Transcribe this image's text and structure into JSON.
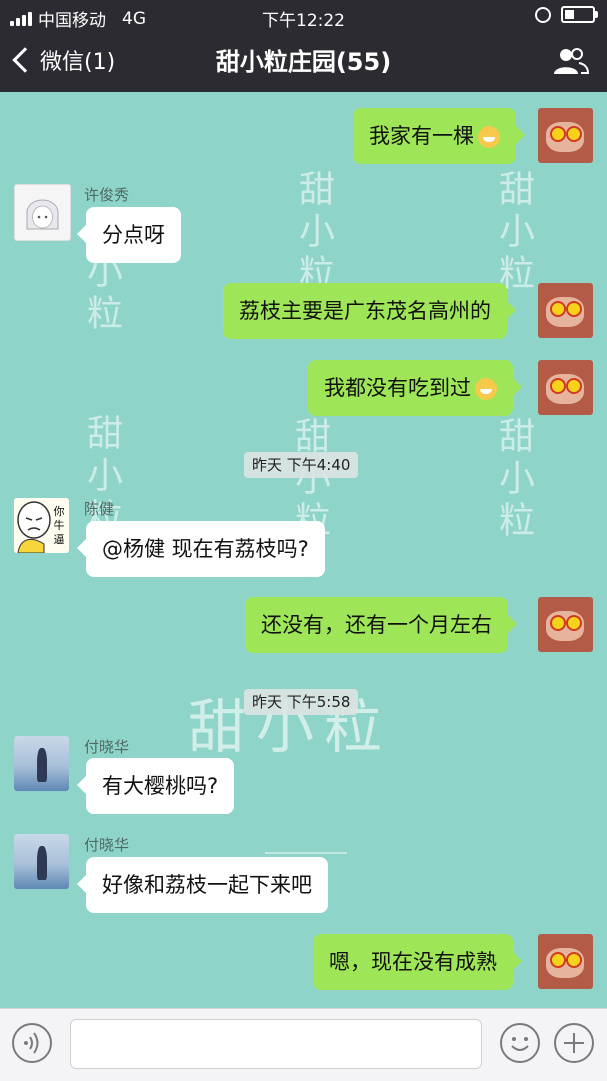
{
  "status_bar": {
    "carrier": "中国移动",
    "network": "4G",
    "time": "下午12:22"
  },
  "header": {
    "back_label": "微信(1)",
    "title": "甜小粒庄园(55)",
    "group_icon": "group-members-icon"
  },
  "watermark": {
    "small": "甜小粒",
    "big": "甜小粒"
  },
  "messages": [
    {
      "side": "right",
      "text": "我家有一棵",
      "emoji": "grinning-face"
    },
    {
      "side": "left",
      "sender": "许俊秀",
      "text": "分点呀"
    },
    {
      "side": "right",
      "text": "荔枝主要是广东茂名高州的"
    },
    {
      "side": "right",
      "text": "我都没有吃到过",
      "emoji": "crying-face"
    },
    {
      "type": "time",
      "text": "昨天 下午4:40"
    },
    {
      "side": "left",
      "sender": "陈健",
      "text": "@杨健 现在有荔枝吗?",
      "avatar_text": "你 牛 逼"
    },
    {
      "side": "right",
      "text": "还没有，还有一个月左右"
    },
    {
      "type": "time",
      "text": "昨天 下午5:58"
    },
    {
      "side": "left",
      "sender": "付晓华",
      "text": "有大樱桃吗?"
    },
    {
      "side": "left",
      "sender": "付晓华",
      "text": "好像和荔枝一起下来吧"
    },
    {
      "side": "right",
      "text": "嗯，现在没有成熟"
    }
  ],
  "input_bar": {
    "voice_icon": "voice-icon",
    "emoji_icon": "emoji-icon",
    "plus_icon": "plus-icon",
    "input_value": ""
  }
}
